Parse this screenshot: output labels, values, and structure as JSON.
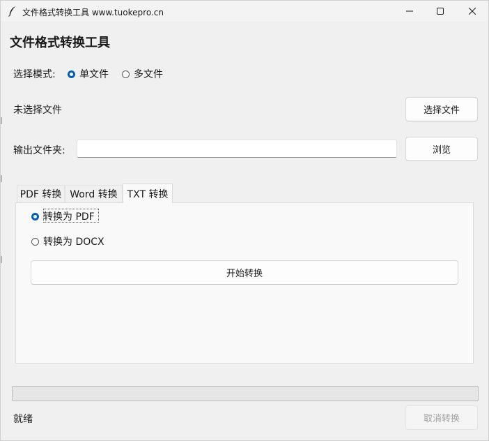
{
  "window": {
    "title": "文件格式转换工具  www.tuokepro.cn"
  },
  "header": {
    "title": "文件格式转换工具"
  },
  "mode": {
    "label": "选择模式:",
    "options": [
      {
        "label": "单文件",
        "checked": true
      },
      {
        "label": "多文件",
        "checked": false
      }
    ]
  },
  "file": {
    "status": "未选择文件",
    "select_button": "选择文件"
  },
  "output": {
    "label": "输出文件夹:",
    "value": "",
    "browse_button": "浏览"
  },
  "tabs": [
    {
      "label": "PDF 转换",
      "active": false
    },
    {
      "label": "Word 转换",
      "active": false
    },
    {
      "label": "TXT 转换",
      "active": true
    }
  ],
  "txt_tab": {
    "options": [
      {
        "label": "转换为 PDF",
        "checked": true
      },
      {
        "label": "转换为 DOCX",
        "checked": false
      }
    ],
    "start_button": "开始转换"
  },
  "footer": {
    "status": "就绪",
    "progress": 0,
    "cancel_button": "取消转换",
    "cancel_enabled": false
  }
}
